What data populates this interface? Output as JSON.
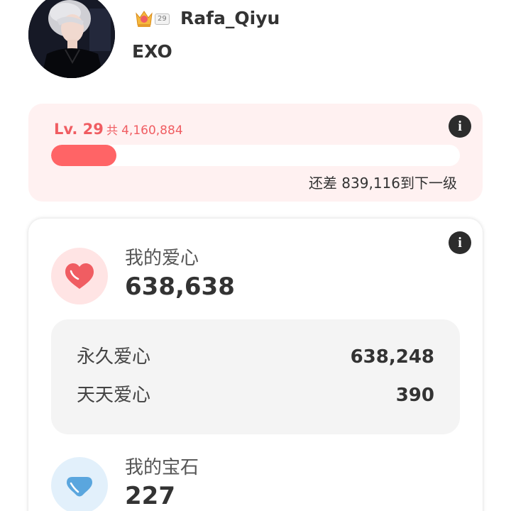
{
  "profile": {
    "username": "Rafa_Qiyu",
    "badge_level": "29",
    "group": "EXO",
    "badge_icon": "crown-badge-icon",
    "avatar": "profile-photo"
  },
  "level": {
    "label": "Lv. 29",
    "total_prefix": "共",
    "total_value": "4,160,884",
    "remaining_text": "还差 839,116到下一级",
    "progress_fraction": 0.16,
    "info_icon": "info-icon",
    "accent_color": "#ff6466",
    "text_color": "#f05d62"
  },
  "hearts": {
    "title": "我的爱心",
    "value": "638,638",
    "icon": "heart-icon",
    "breakdown": [
      {
        "label": "永久爱心",
        "value": "638,248"
      },
      {
        "label": "天天爱心",
        "value": "390"
      }
    ]
  },
  "gems": {
    "title": "我的宝石",
    "value": "227",
    "icon": "gem-icon"
  }
}
